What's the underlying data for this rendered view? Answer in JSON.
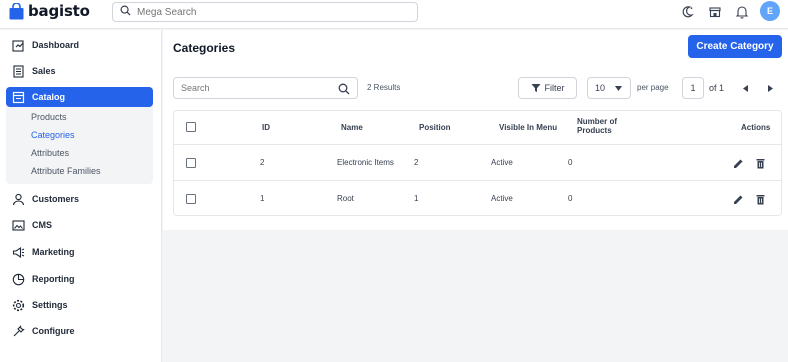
{
  "header": {
    "brand": "bagisto",
    "search_placeholder": "Mega Search",
    "avatar_initial": "E"
  },
  "sidebar": {
    "items": [
      {
        "label": "Dashboard",
        "icon": "dashboard-icon"
      },
      {
        "label": "Sales",
        "icon": "sales-icon"
      },
      {
        "label": "Catalog",
        "icon": "catalog-icon"
      },
      {
        "label": "Customers",
        "icon": "customers-icon"
      },
      {
        "label": "CMS",
        "icon": "cms-icon"
      },
      {
        "label": "Marketing",
        "icon": "marketing-icon"
      },
      {
        "label": "Reporting",
        "icon": "reporting-icon"
      },
      {
        "label": "Settings",
        "icon": "settings-icon"
      },
      {
        "label": "Configure",
        "icon": "configure-icon"
      }
    ],
    "catalog_sub": [
      "Products",
      "Categories",
      "Attributes",
      "Attribute Families"
    ]
  },
  "main": {
    "title": "Categories",
    "create_button": "Create Category",
    "search_placeholder": "Search",
    "results": "2 Results",
    "filter_label": "Filter",
    "per_page_value": "10",
    "per_page_label": "per page",
    "page_current": "1",
    "page_total": "of 1"
  },
  "table": {
    "headers": {
      "id": "ID",
      "name": "Name",
      "position": "Position",
      "visible": "Visible In Menu",
      "products": "Number of Products",
      "actions": "Actions"
    },
    "rows": [
      {
        "id": "2",
        "name": "Electronic Items",
        "position": "2",
        "visible": "Active",
        "products": "0"
      },
      {
        "id": "1",
        "name": "Root",
        "position": "1",
        "visible": "Active",
        "products": "0"
      }
    ]
  },
  "colors": {
    "accent": "#2563eb",
    "avatar": "#60a5fa"
  }
}
